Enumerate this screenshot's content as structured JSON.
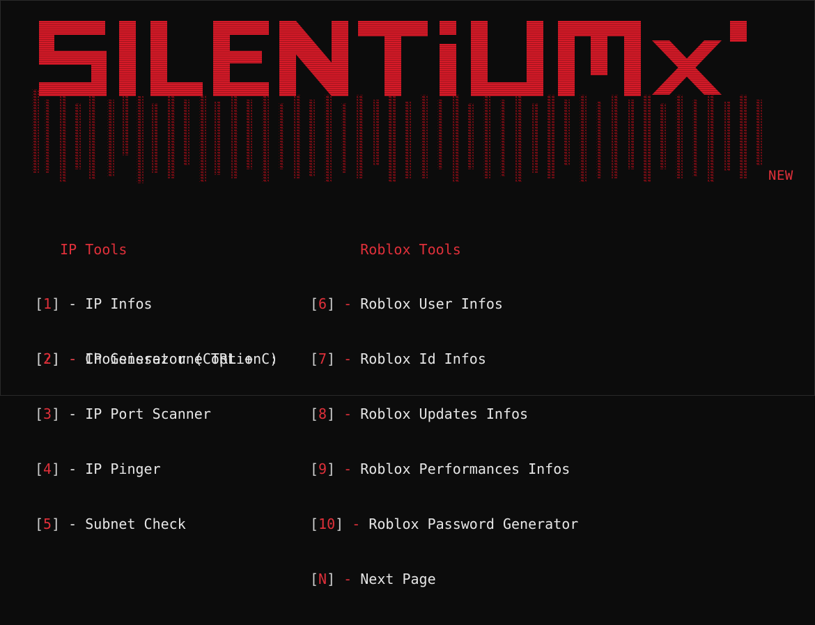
{
  "logo": {
    "text": "SILENTIUMX",
    "primary_color": "#d61a28",
    "shadow_color": "#7a0e16"
  },
  "badge": "NEW",
  "sections": {
    "left": {
      "heading": "IP Tools",
      "items": [
        {
          "key": "1",
          "label": "IP Infos"
        },
        {
          "key": "2",
          "label": "IP Generator (CTRL + C)"
        },
        {
          "key": "3",
          "label": "IP Port Scanner"
        },
        {
          "key": "4",
          "label": "IP Pinger"
        },
        {
          "key": "5",
          "label": "Subnet Check"
        }
      ]
    },
    "right": {
      "heading": "Roblox Tools",
      "items": [
        {
          "key": "6",
          "label": "Roblox User Infos"
        },
        {
          "key": "7",
          "label": "Roblox Id Infos"
        },
        {
          "key": "8",
          "label": "Roblox Updates Infos"
        },
        {
          "key": "9",
          "label": "Roblox Performances Infos"
        },
        {
          "key": "10",
          "label": "Roblox Password Generator"
        },
        {
          "key": "N",
          "label": "Next Page"
        }
      ]
    }
  },
  "prompt": {
    "key": "?",
    "text": "Choisissez une option :"
  },
  "colors": {
    "background": "#0c0c0c",
    "accent": "#e0303a",
    "text": "#e6e6e6"
  }
}
